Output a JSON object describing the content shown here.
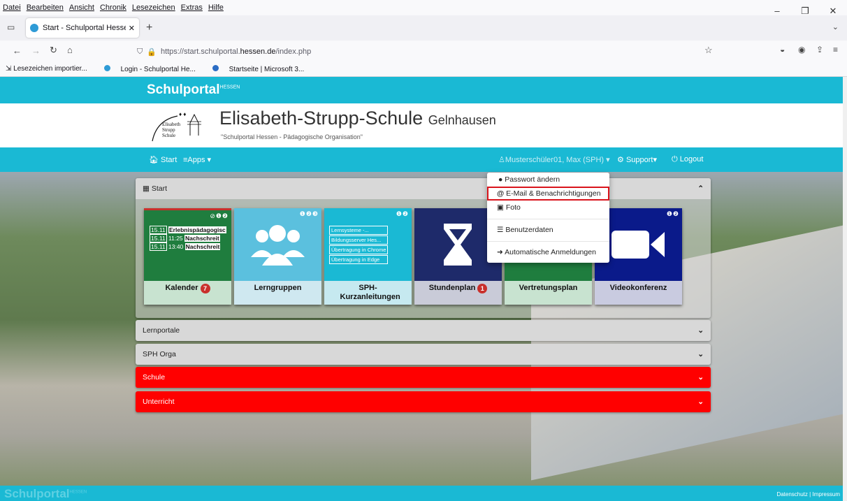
{
  "browser": {
    "menu": [
      "Datei",
      "Bearbeiten",
      "Ansicht",
      "Chronik",
      "Lesezeichen",
      "Extras",
      "Hilfe"
    ],
    "tab_title": "Start - Schulportal Hessen - Päd",
    "url_prefix": "https://start.schulportal.",
    "url_domain": "hessen.de",
    "url_suffix": "/index.php",
    "bookmarks": [
      "Lesezeichen importier...",
      "Login - Schulportal He...",
      "Startseite | Microsoft 3..."
    ]
  },
  "site": {
    "brand": "Schulportal",
    "brand_sup": "HESSEN",
    "school_name": "Elisabeth-Strupp-Schule",
    "school_city": "Gelnhausen",
    "subtitle": "\"Schulportal Hessen - Pädagogische Organisation\"",
    "logo_text": [
      "Elisabeth",
      "Strupp",
      "Schule"
    ]
  },
  "nav": {
    "start": "Start",
    "apps": "Apps",
    "user": "Musterschüler01, Max (SPH)",
    "support": "Support",
    "logout": "Logout"
  },
  "dropdown": [
    "Passwort ändern",
    "E-Mail & Benachrichtigungen",
    "Foto",
    "Benutzerdaten",
    "Automatische Anmeldungen"
  ],
  "panels": {
    "start": "Start",
    "lernportale": "Lernportale",
    "sph_orga": "SPH Orga",
    "schule": "Schule",
    "unterricht": "Unterricht"
  },
  "tiles": [
    {
      "label": "Kalender",
      "badge": "7"
    },
    {
      "label": "Lerngruppen"
    },
    {
      "label": "SPH-Kurzanleitungen"
    },
    {
      "label": "Stundenplan",
      "badge": "1"
    },
    {
      "label": "Vertretungsplan"
    },
    {
      "label": "Videokonferenz"
    }
  ],
  "calendar": [
    [
      "15.11",
      "Erlebnispädagogisc"
    ],
    [
      "15.11",
      "11:25",
      "Nachschreit"
    ],
    [
      "15.11",
      "13:40",
      "Nachschreit"
    ]
  ],
  "kurz": [
    "Lernsysteme -...",
    "Bildungsserver Hes...",
    "Übertragung in Chrome",
    "Übertragung in Edge"
  ],
  "footer": {
    "brand": "Schulportal",
    "brand_sup": "HESSEN",
    "links": "Datenschutz | Impressum"
  },
  "colors": {
    "accent": "#1ab9d4",
    "red": "#ff0000",
    "highlight": "#d9141c"
  }
}
